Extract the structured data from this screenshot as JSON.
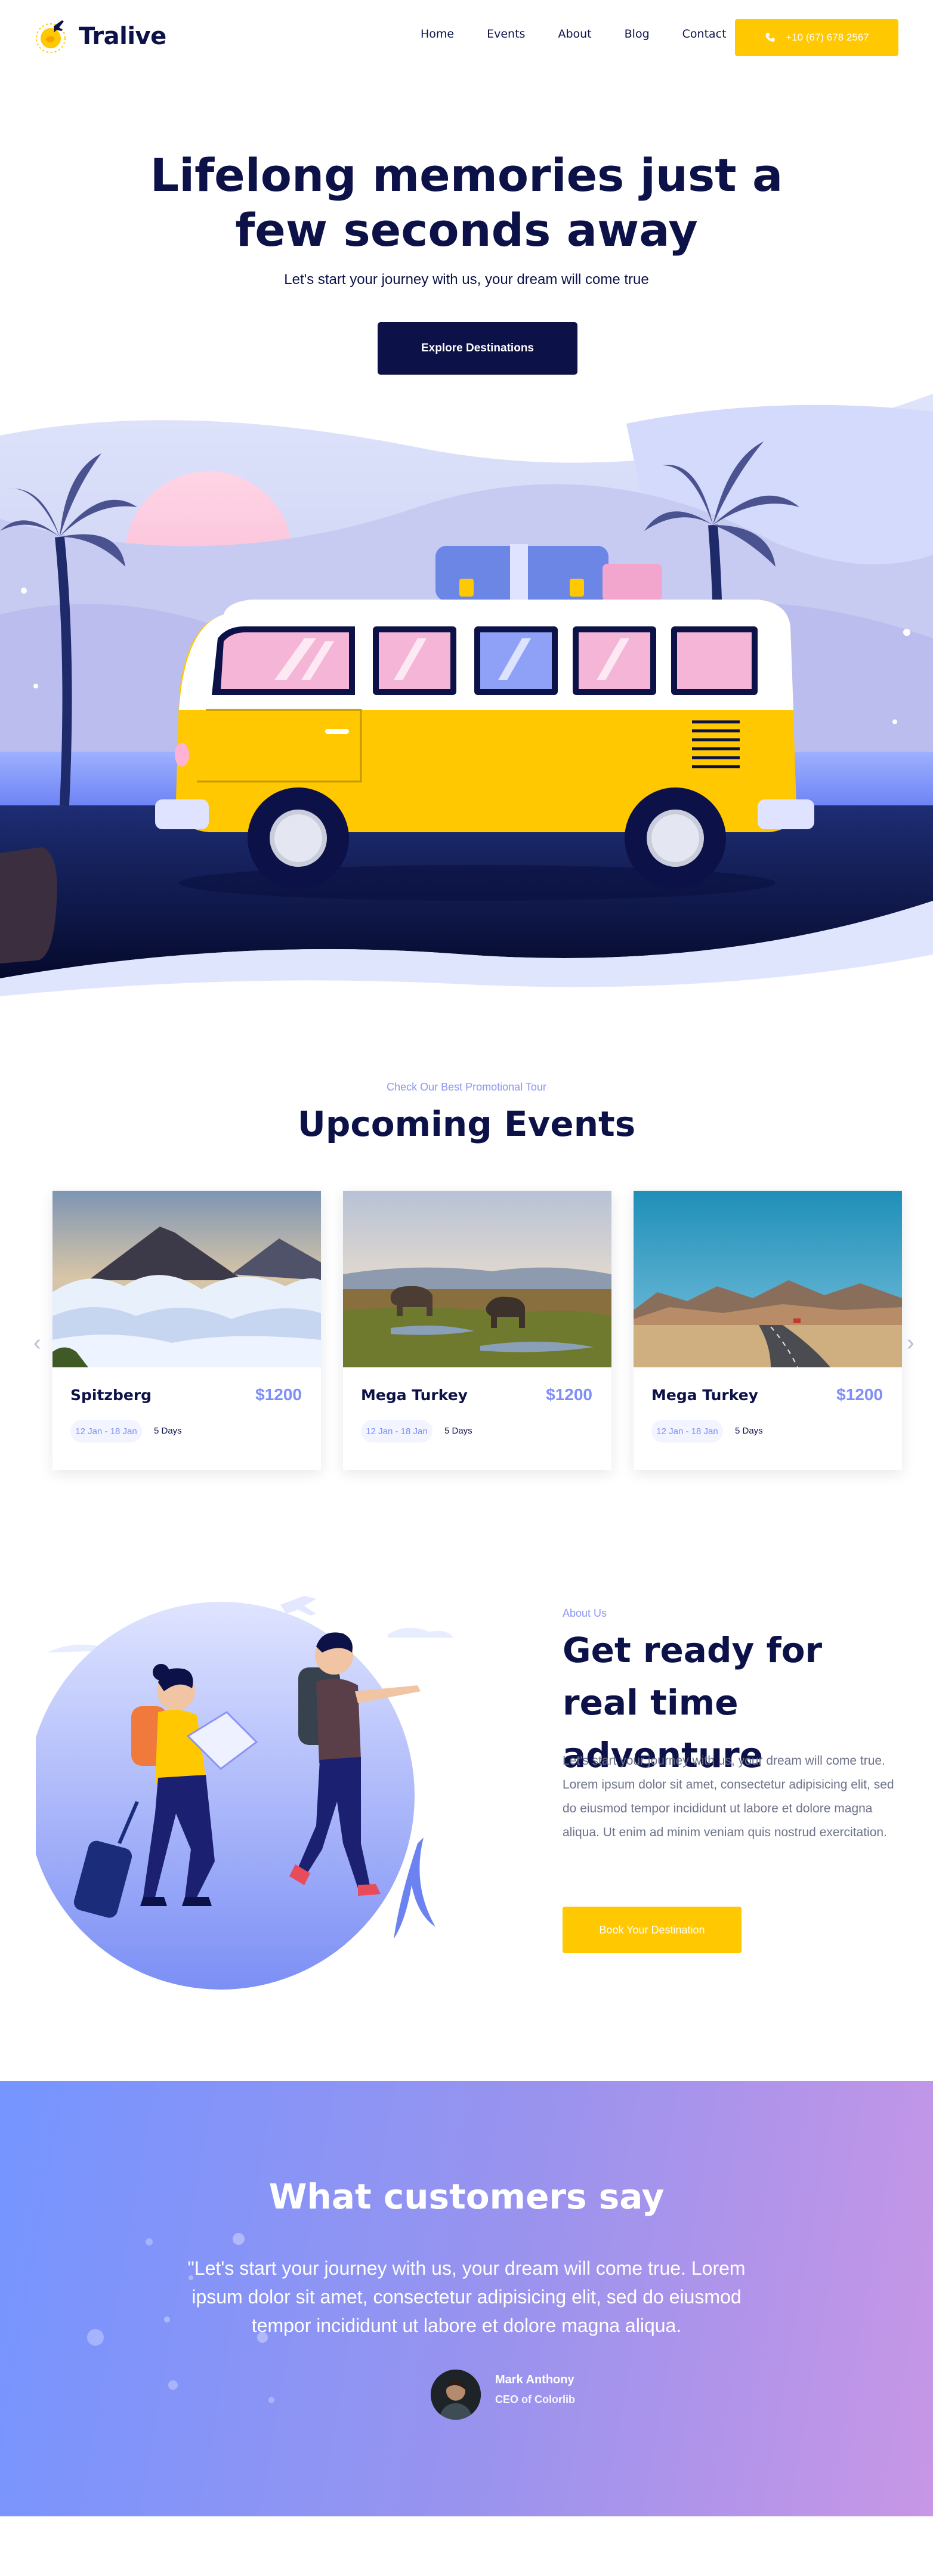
{
  "header": {
    "logo_text": "Tralive",
    "menu": [
      "Home",
      "Events",
      "About",
      "Blog",
      "Contact"
    ],
    "phone": "+10 (67) 678 2567",
    "phone_icon": "phone-icon"
  },
  "hero": {
    "title_line1": "Lifelong memories just a",
    "title_line2": "few seconds away",
    "subtitle": "Let's start your journey with us, your dream will come true",
    "button": "Explore Destinations"
  },
  "events": {
    "kicker": "Check Our Best Promotional Tour",
    "title": "Upcoming Events",
    "prev_icon": "chevron-left-icon",
    "next_icon": "chevron-right-icon",
    "cards": [
      {
        "name": "Spitzberg",
        "price": "$1200",
        "date": "12 Jan - 18 Jan",
        "days": "5 Days"
      },
      {
        "name": "Mega Turkey",
        "price": "$1200",
        "date": "12 Jan - 18 Jan",
        "days": "5 Days"
      },
      {
        "name": "Mega Turkey",
        "price": "$1200",
        "date": "12 Jan - 18 Jan",
        "days": "5 Days"
      }
    ]
  },
  "about": {
    "kicker": "About Us",
    "title": "Get ready for real time adventure",
    "text": "Let's start your journey with us, your dream will come true. Lorem ipsum dolor sit amet, consectetur adipisicing elit, sed do eiusmod tempor incididunt ut labore et dolore magna aliqua. Ut enim ad minim veniam quis nostrud exercitation.",
    "button": "Book Your Destination"
  },
  "testimonial": {
    "title": "What customers say",
    "quote": "\"Let's start your journey with us, your dream will come true. Lorem ipsum dolor sit amet, consectetur adipisicing elit, sed do eiusmod tempor incididunt ut labore et dolore magna aliqua.",
    "author": "Mark Anthony",
    "role": "CEO of Colorlib"
  },
  "colors": {
    "navy": "#0c1147",
    "yellow": "#ffc800",
    "accent": "#7f8ef5"
  }
}
